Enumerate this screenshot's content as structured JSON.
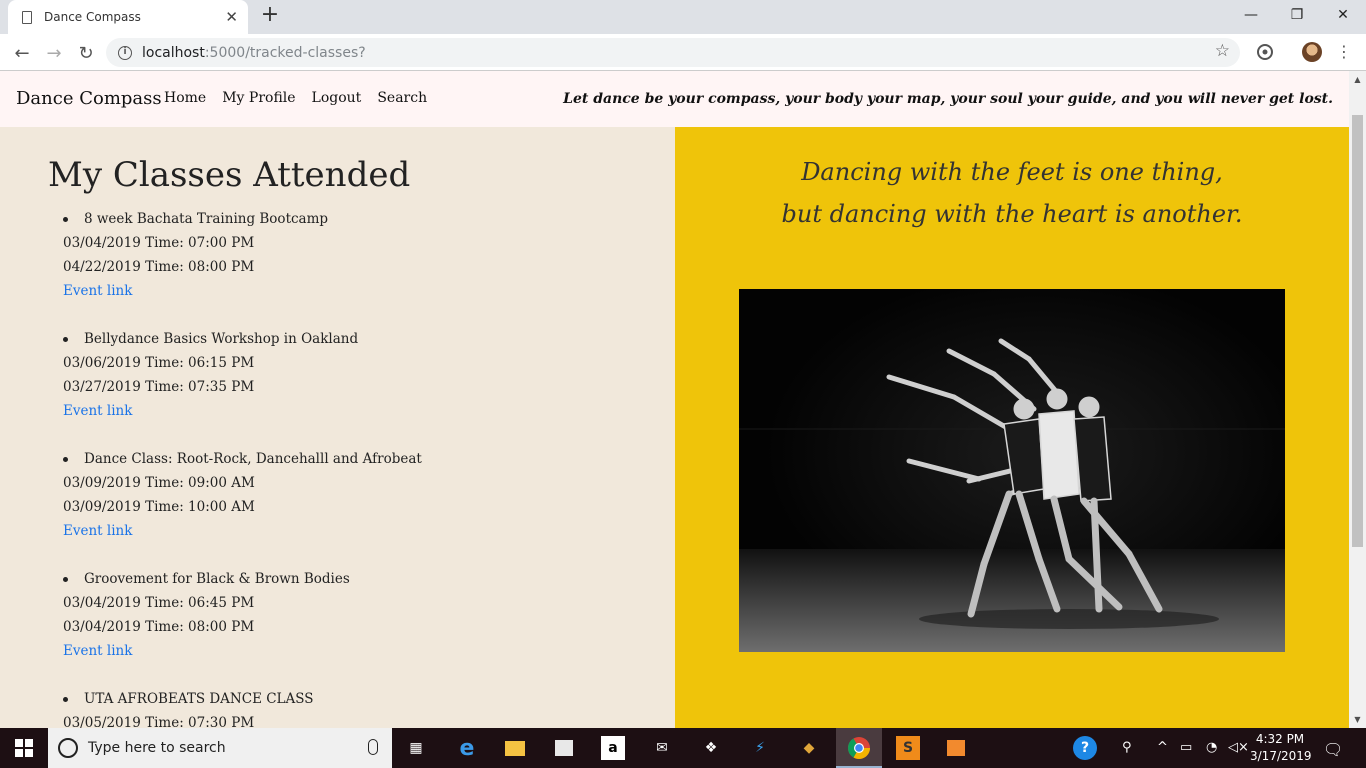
{
  "browser": {
    "tab_title": "Dance Compass",
    "url_host": "localhost",
    "url_path": ":5000/tracked-classes?",
    "window_controls": {
      "minimize": "—",
      "restore": "❐",
      "close": "✕"
    }
  },
  "site": {
    "brand": "Dance Compass",
    "nav": [
      "Home",
      "My Profile",
      "Logout",
      "Search"
    ],
    "tagline": "Let dance be your compass, your body your map, your soul your guide, and you will never get lost."
  },
  "main": {
    "heading": "My Classes Attended",
    "classes": [
      {
        "name": "8 week Bachata Training Bootcamp",
        "start": "03/04/2019 Time: 07:00 PM",
        "end": "04/22/2019 Time: 08:00 PM",
        "link": "Event link"
      },
      {
        "name": "Bellydance Basics Workshop in Oakland",
        "start": "03/06/2019 Time: 06:15 PM",
        "end": "03/27/2019 Time: 07:35 PM",
        "link": "Event link"
      },
      {
        "name": "Dance Class: Root-Rock, Dancehalll and Afrobeat",
        "start": "03/09/2019 Time: 09:00 AM",
        "end": "03/09/2019 Time: 10:00 AM",
        "link": "Event link"
      },
      {
        "name": "Groovement for Black & Brown Bodies",
        "start": "03/04/2019 Time: 06:45 PM",
        "end": "03/04/2019 Time: 08:00 PM",
        "link": "Event link"
      },
      {
        "name": "UTA AFROBEATS DANCE CLASS",
        "start": "03/05/2019 Time: 07:30 PM",
        "end": "",
        "link": ""
      }
    ]
  },
  "aside": {
    "quote_line1": "Dancing with the feet is one thing,",
    "quote_line2": "but dancing with the heart is another."
  },
  "taskbar": {
    "search_placeholder": "Type here to search",
    "time": "4:32 PM",
    "date": "3/17/2019"
  },
  "colors": {
    "nav_bg": "#fff5f5",
    "left_bg": "#f1e8db",
    "right_bg": "#efc40a",
    "link": "#1a73e8"
  }
}
